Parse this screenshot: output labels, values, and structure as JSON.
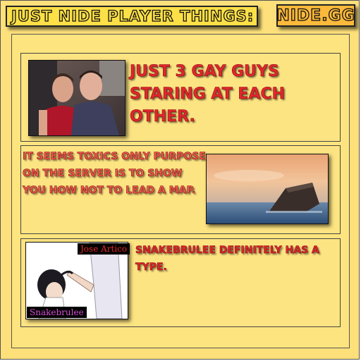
{
  "header": {
    "title": "JUST NIDE PLAYER THINGS:",
    "brand": "NIDE.GG"
  },
  "panels": [
    {
      "caption": "JUST 3 GAY GUYS STARING AT EACH OTHER.",
      "image": "two-men-photo"
    },
    {
      "caption": "IT SEEMS TOXICS ONLY PURPOSE ON THE SERVER IS TO SHOW YOU HOW NOT TO LEAD A MAP.",
      "image": "sinking-ship-photo"
    },
    {
      "caption": "SNAKEBRULEE DEFINITELY HAS A TYPE.",
      "image": "anime-drawing",
      "labels": [
        "Jose Artico",
        "Snakebrulee"
      ]
    }
  ],
  "colors": {
    "background": "#fde07a",
    "title_fill": "#fde047",
    "brand_fill": "#fcb93b",
    "caption_red": "#e4262c"
  }
}
